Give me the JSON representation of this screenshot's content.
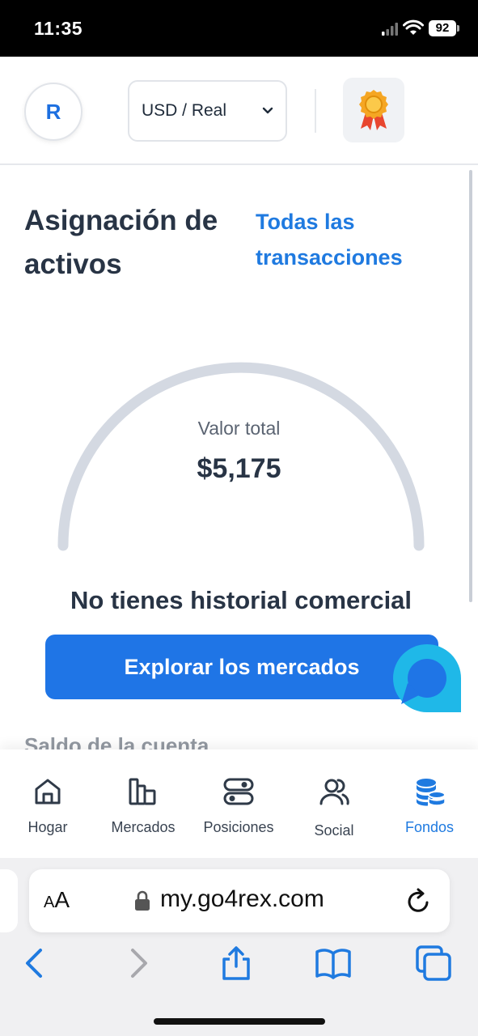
{
  "status_bar": {
    "time": "11:35",
    "battery": "92"
  },
  "header": {
    "avatar_initial": "R",
    "currency_selector": "USD / Real"
  },
  "main": {
    "title": "Asignación de activos",
    "all_transactions_link": "Todas las transacciones",
    "gauge": {
      "label": "Valor total",
      "value": "$5,175"
    },
    "empty_message": "No tienes historial comercial",
    "explore_button": "Explorar los mercados",
    "next_section_peek": "Saldo de la cuenta"
  },
  "bottom_nav": {
    "items": [
      {
        "label": "Hogar",
        "icon": "home-icon"
      },
      {
        "label": "Mercados",
        "icon": "bar-chart-icon"
      },
      {
        "label": "Posiciones",
        "icon": "toggles-icon"
      },
      {
        "label": "Social",
        "icon": "users-icon"
      },
      {
        "label": "Fondos",
        "icon": "coins-icon"
      }
    ],
    "active_index": 4
  },
  "browser": {
    "text_size_label": "AA",
    "url": "my.go4rex.com"
  },
  "colors": {
    "accent": "#1f7ae0",
    "button": "#1f75e6",
    "text": "#283445",
    "gauge_track": "#d4d9e2"
  }
}
